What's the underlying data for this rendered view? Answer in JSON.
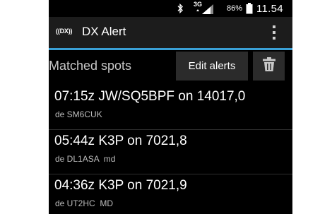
{
  "status_bar": {
    "network_label": "3G",
    "battery_percent": "86%",
    "time": "11.54",
    "icons": [
      "bluetooth-icon",
      "signal-icon",
      "battery-icon"
    ]
  },
  "action_bar": {
    "logo_text": "((DX))",
    "title": "DX Alert",
    "overflow_icon": "overflow-menu-icon",
    "accent_color": "#3aa0d6"
  },
  "section": {
    "title": "Matched spots",
    "edit_button_label": "Edit alerts",
    "delete_icon": "trash-icon"
  },
  "spots": [
    {
      "main": "07:15z JW/SQ5BPF on 14017,0",
      "sub": "de SM6CUK"
    },
    {
      "main": "05:44z K3P on 7021,8",
      "sub": "de DL1ASA  md"
    },
    {
      "main": "04:36z K3P on 7021,9",
      "sub": "de UT2HC  MD"
    }
  ]
}
